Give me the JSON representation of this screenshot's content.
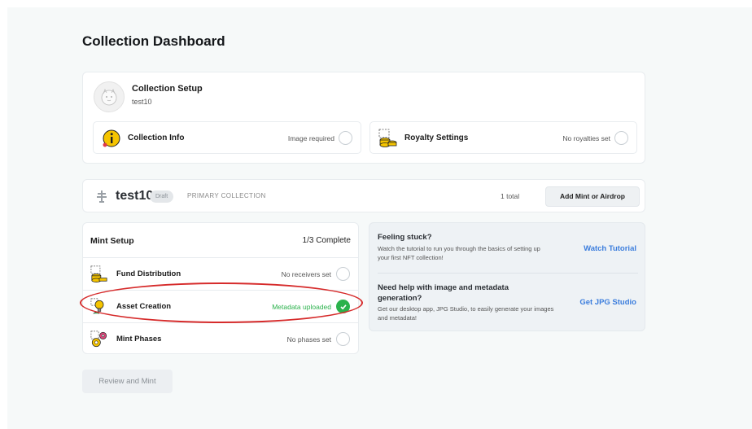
{
  "page": {
    "title": "Collection Dashboard"
  },
  "collection_setup": {
    "title": "Collection Setup",
    "name": "test10",
    "info": {
      "label": "Collection Info",
      "status": "Image required"
    },
    "royalty": {
      "label": "Royalty Settings",
      "status": "No royalties set"
    }
  },
  "collection_bar": {
    "name": "test10",
    "badge": "Draft",
    "type": "PRIMARY COLLECTION",
    "total": "1 total",
    "add_button": "Add Mint or Airdrop"
  },
  "mint_setup": {
    "title": "Mint Setup",
    "progress": "1/3 Complete",
    "rows": [
      {
        "label": "Fund Distribution",
        "status": "No receivers set",
        "done": false
      },
      {
        "label": "Asset Creation",
        "status": "Metadata uploaded",
        "done": true
      },
      {
        "label": "Mint Phases",
        "status": "No phases set",
        "done": false
      }
    ]
  },
  "help": {
    "stuck": {
      "title": "Feeling stuck?",
      "desc": "Watch the tutorial to run you through the basics of setting up your first NFT collection!",
      "link": "Watch Tutorial"
    },
    "metadata": {
      "title": "Need help with image and metadata generation?",
      "desc": "Get our desktop app, JPG Studio, to easily generate your images and metadata!",
      "link": "Get JPG Studio"
    }
  },
  "review_button": "Review and Mint",
  "colors": {
    "accent_link": "#3b7ddd",
    "success": "#2bb24c",
    "highlight": "#d62b2b"
  }
}
